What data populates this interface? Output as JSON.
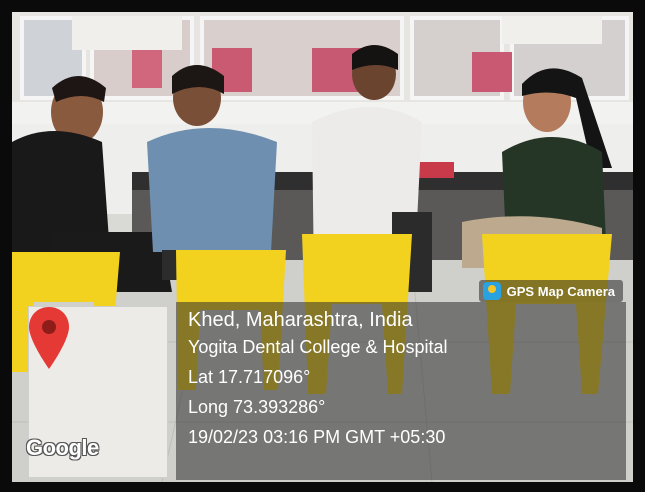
{
  "watermark": {
    "app_label": "GPS Map Camera",
    "map_brand": "Google",
    "location_title": "Khed, Maharashtra, India",
    "place_name": "Yogita Dental College & Hospital",
    "latitude": "Lat 17.717096°",
    "longitude": "Long 73.393286°",
    "timestamp": "19/02/23 03:16 PM GMT +05:30"
  },
  "colors": {
    "pin": "#e53935",
    "stool": "#f2d21f",
    "badge_icon": "#2aa2e0"
  }
}
